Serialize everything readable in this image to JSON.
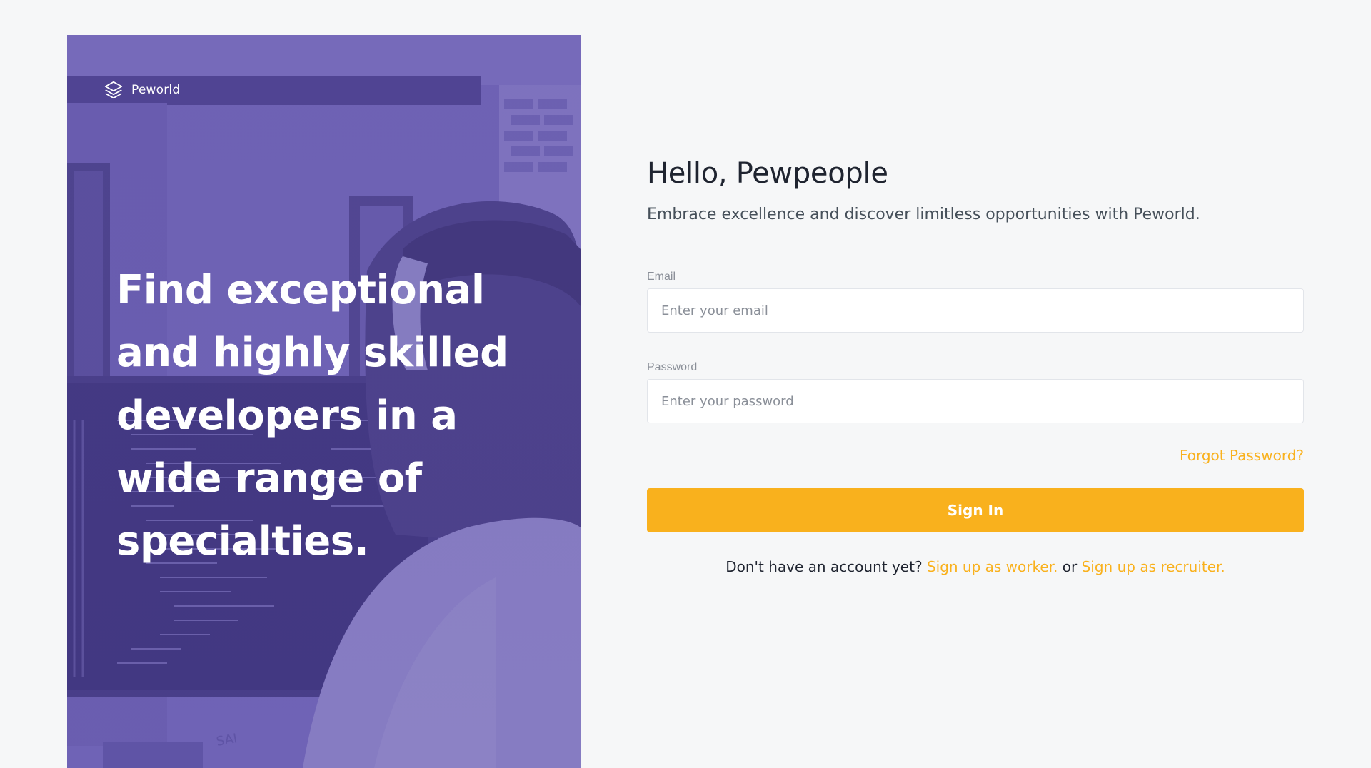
{
  "brand": {
    "name": "Peworld",
    "icon": "layers-icon"
  },
  "hero": {
    "headline": "Find exceptional and highly skilled developers in a wide range of specialties."
  },
  "login": {
    "title": "Hello, Pewpeople",
    "subtitle": "Embrace excellence and discover limitless opportunities with Peworld.",
    "email": {
      "label": "Email",
      "placeholder": "Enter your email",
      "value": ""
    },
    "password": {
      "label": "Password",
      "placeholder": "Enter your password",
      "value": ""
    },
    "forgot_label": "Forgot Password?",
    "submit_label": "Sign In",
    "signup": {
      "prompt": "Don't have an account yet?",
      "worker_label": "Sign up as worker.",
      "or_text": "or",
      "recruiter_label": "Sign up as recruiter."
    }
  },
  "colors": {
    "accent": "#f9b11d",
    "hero_overlay": "#6d62b4",
    "page_background": "#f6f7f8",
    "heading_text": "#1f2430"
  }
}
